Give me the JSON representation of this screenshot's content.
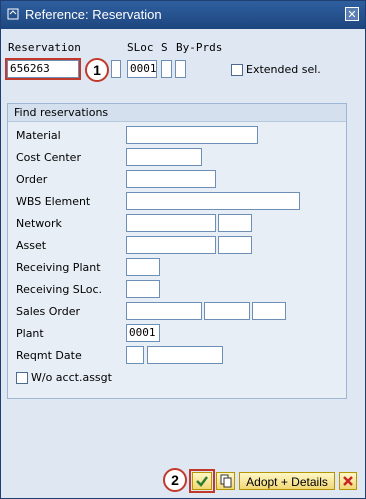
{
  "title": "Reference: Reservation",
  "top": {
    "reservation_label": "Reservation",
    "reservation_value": "656263",
    "sloc_label": "SLoc",
    "s_label": "S",
    "byprds_label": "By-Prds",
    "sloc_value": "0001",
    "extended_sel_label": "Extended sel."
  },
  "find": {
    "title": "Find reservations",
    "rows": [
      {
        "label": "Material"
      },
      {
        "label": "Cost Center"
      },
      {
        "label": "Order"
      },
      {
        "label": "WBS Element"
      },
      {
        "label": "Network"
      },
      {
        "label": "Asset"
      },
      {
        "label": "Receiving Plant"
      },
      {
        "label": "Receiving SLoc."
      },
      {
        "label": "Sales Order"
      },
      {
        "label": "Plant",
        "value": "0001"
      },
      {
        "label": "Reqmt Date"
      }
    ],
    "wo_label": "W/o acct.assgt"
  },
  "callouts": {
    "one": "1",
    "two": "2"
  },
  "buttons": {
    "adopt_details": "Adopt + Details"
  },
  "colors": {
    "accent": "#c0392b",
    "titlebar": "#1d467f"
  }
}
